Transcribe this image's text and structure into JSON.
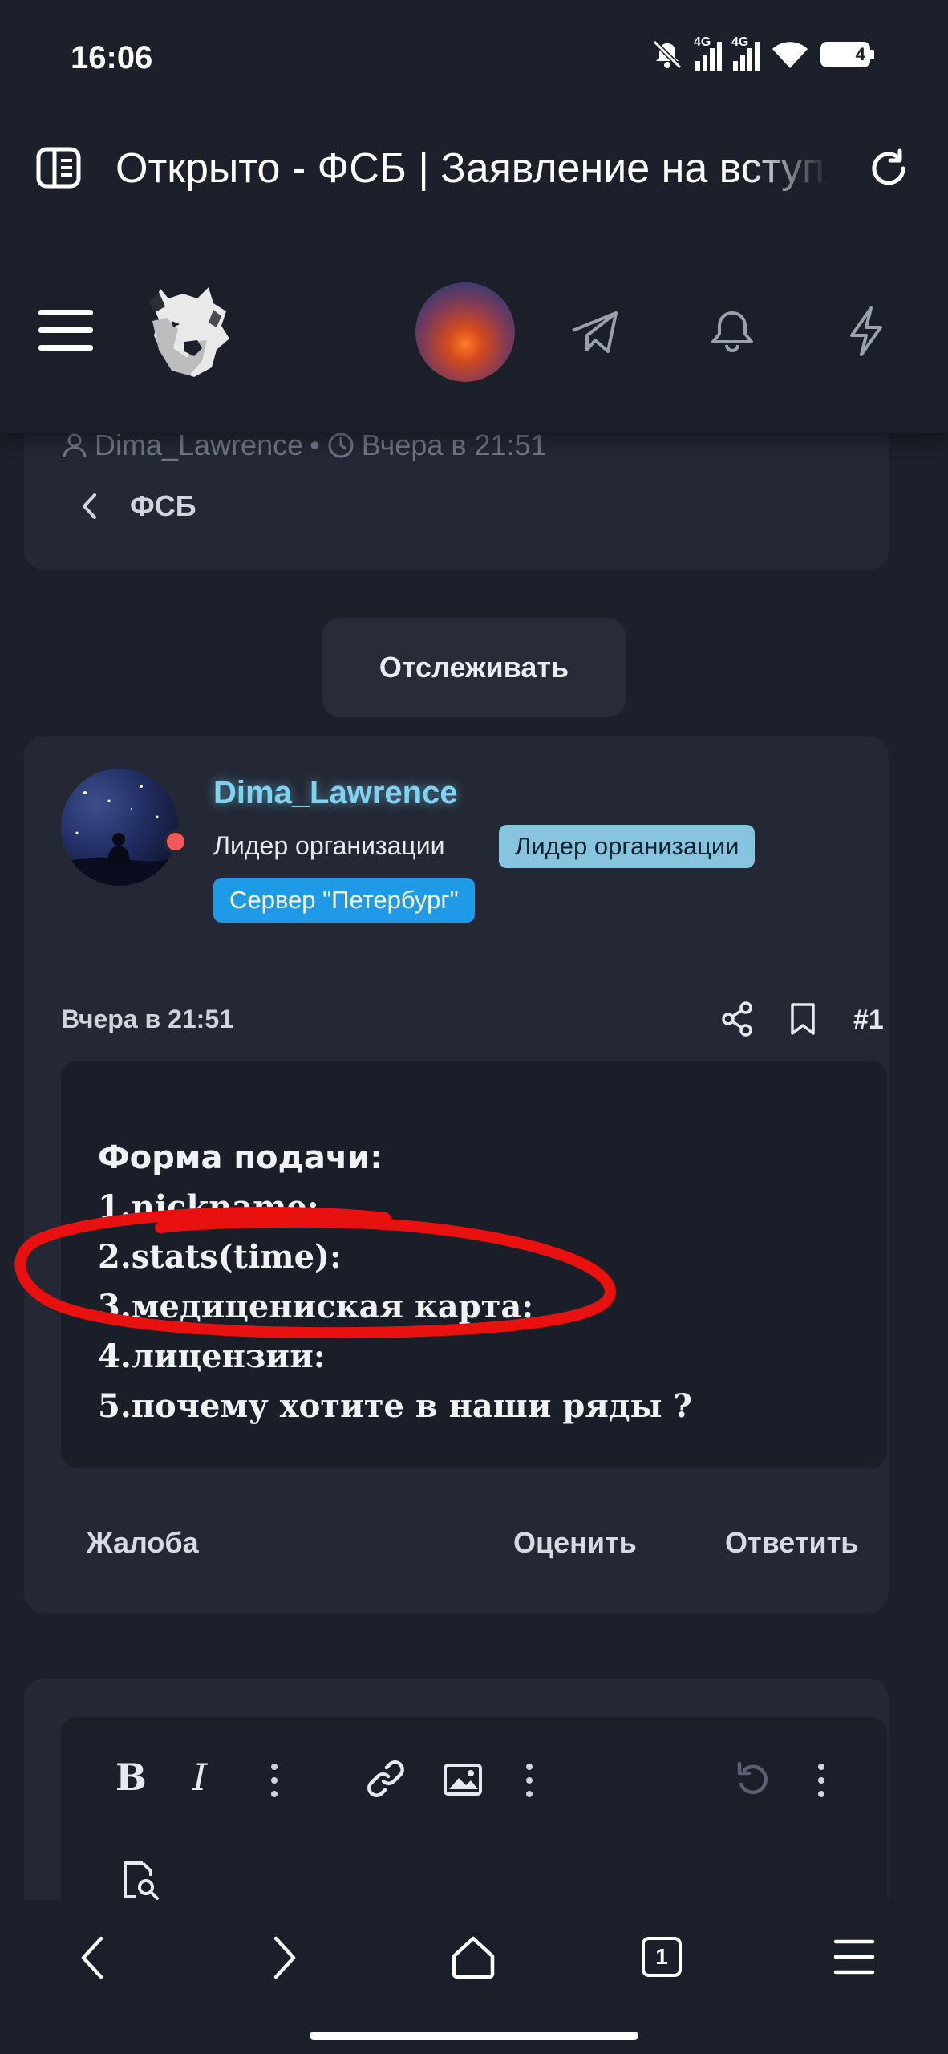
{
  "status_bar": {
    "time": "16:06",
    "signal_1": "4G",
    "signal_2": "4G",
    "battery": "4"
  },
  "browser": {
    "page_title": "Открыто - ФСБ | Заявление на вступление"
  },
  "thread": {
    "author": "Dima_Lawrence",
    "separator": "•",
    "date": "Вчера в 21:51",
    "breadcrumb": "ФСБ"
  },
  "follow_label": "Отслеживать",
  "post": {
    "username": "Dima_Lawrence",
    "role_text": "Лидер организации",
    "role_badge": "Лидер организации",
    "server_badge": "Сервер \"Петербург\"",
    "date": "Вчера в 21:51",
    "number": "#1",
    "lines": [
      "Форма подачи:",
      "1.nickname:",
      "2.stats(time):",
      "3.медицениская карта:",
      "4.лицензии:",
      "5.почему хотите в наши ряды ?"
    ],
    "actions": {
      "report": "Жалоба",
      "rate": "Оценить",
      "reply": "Ответить"
    }
  },
  "editor": {
    "bold": "B",
    "italic": "I"
  },
  "bottom_nav": {
    "tabs_count": "1"
  },
  "colors": {
    "background": "#1c202a",
    "card": "#232834",
    "accent": "#1f9ae6",
    "username": "#7fd3f0",
    "highlight_circle": "#e8110f"
  }
}
